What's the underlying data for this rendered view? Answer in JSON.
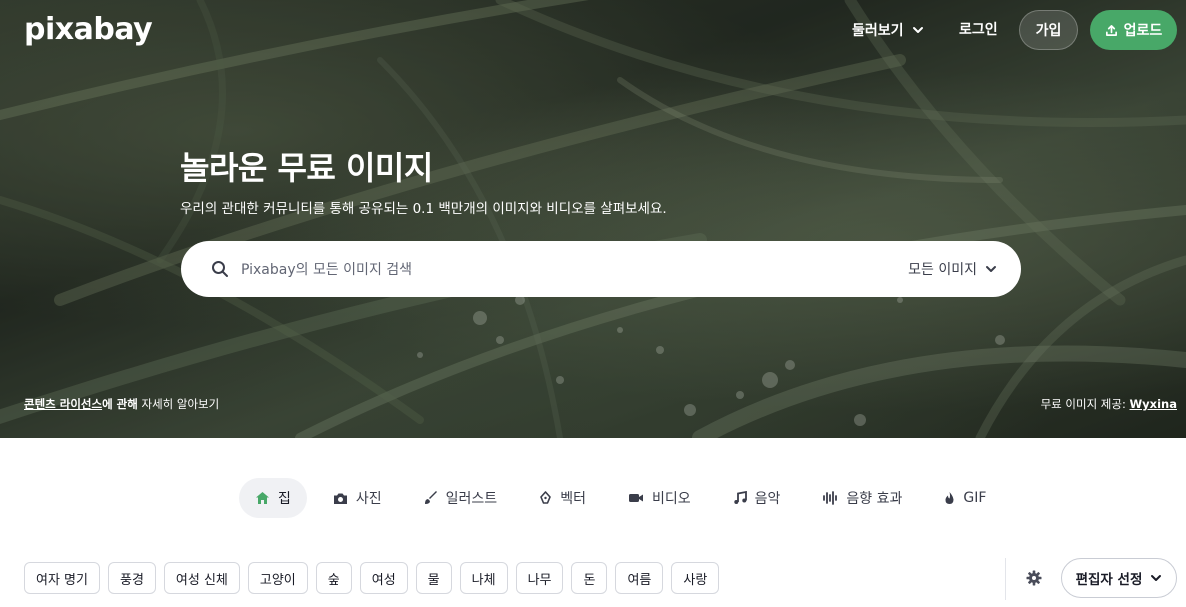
{
  "header": {
    "logo": "pixabay",
    "explore_label": "둘러보기",
    "login_label": "로그인",
    "join_label": "가입",
    "upload_label": "업로드"
  },
  "hero": {
    "title": "놀라운 무료 이미지",
    "subtitle": "우리의 관대한 커뮤니티를 통해 공유되는 0.1 백만개의 이미지와 비디오를 살펴보세요.",
    "search": {
      "placeholder": "Pixabay의 모든 이미지 검색",
      "filter_label": "모든 이미지"
    },
    "license": {
      "link_text": "콘텐츠 라이선스",
      "bold_text": "에 관해",
      "rest_text": " 자세히 알아보기"
    },
    "credit": {
      "prefix": "무료 이미지 제공: ",
      "author": "Wyxina"
    }
  },
  "tabs": [
    {
      "label": "집",
      "icon": "home-icon",
      "active": true
    },
    {
      "label": "사진",
      "icon": "camera-icon"
    },
    {
      "label": "일러스트",
      "icon": "brush-icon"
    },
    {
      "label": "벡터",
      "icon": "pen-nib-icon"
    },
    {
      "label": "비디오",
      "icon": "video-camera-icon"
    },
    {
      "label": "음악",
      "icon": "music-note-icon"
    },
    {
      "label": "음향 효과",
      "icon": "sound-wave-icon"
    },
    {
      "label": "GIF",
      "icon": "flame-icon"
    }
  ],
  "chips": [
    "여자 명기",
    "풍경",
    "여성 신체",
    "고양이",
    "숲",
    "여성",
    "물",
    "나체",
    "나무",
    "돈",
    "여름",
    "사랑"
  ],
  "sort": {
    "label": "편집자 선정"
  },
  "colors": {
    "upload_button": "#48a868",
    "text_dark": "#191b26"
  }
}
